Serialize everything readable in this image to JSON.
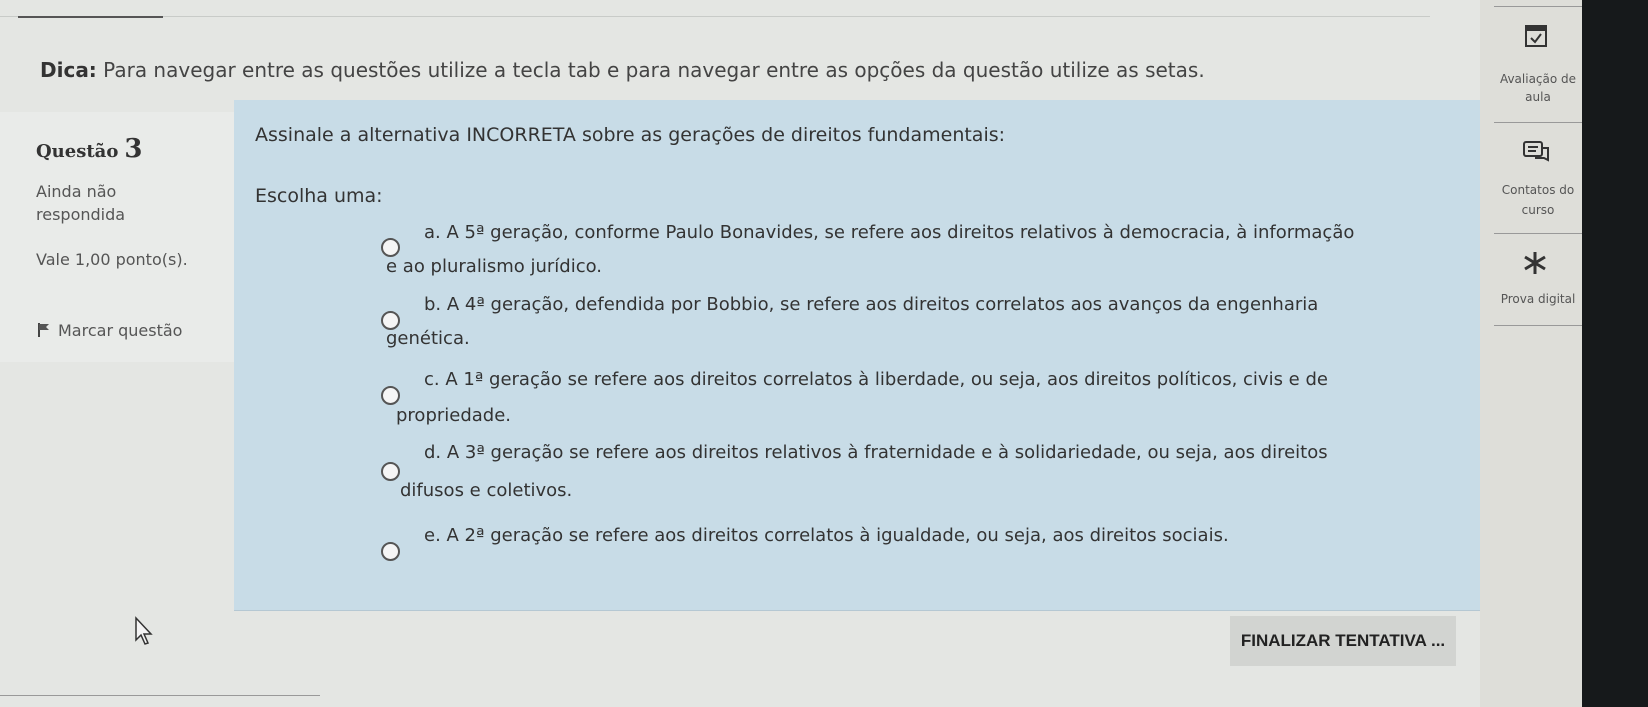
{
  "hint": {
    "label": "Dica:",
    "text": "Para navegar entre as questões utilize a tecla tab e para navegar entre as opções da questão utilize as setas."
  },
  "question": {
    "label": "Questão",
    "number": "3",
    "status": "Ainda não respondida",
    "value": "Vale 1,00 ponto(s).",
    "flag_label": "Marcar questão"
  },
  "prompt": "Assinale a alternativa INCORRETA sobre as gerações de direitos fundamentais:",
  "choose": "Escolha uma:",
  "options": [
    {
      "line1": "a. A 5ª geração, conforme Paulo Bonavides, se refere aos direitos relativos à democracia, à informação",
      "line2": "e ao pluralismo jurídico."
    },
    {
      "line1": "b. A 4ª geração, defendida por Bobbio, se refere aos direitos correlatos aos avanços da engenharia",
      "line2": "genética."
    },
    {
      "line1": "c. A 1ª geração se refere aos direitos correlatos à liberdade, ou seja, aos direitos políticos, civis e de",
      "line2": "propriedade."
    },
    {
      "line1": "d. A 3ª geração se refere aos direitos relativos à fraternidade e à solidariedade, ou seja, aos direitos",
      "line2": "difusos e coletivos."
    },
    {
      "line1": "e. A 2ª geração se refere aos direitos correlatos à igualdade, ou seja, aos direitos sociais.",
      "line2": ""
    }
  ],
  "finish_button": "FINALIZAR TENTATIVA ...",
  "rail": {
    "items": [
      {
        "label": "Avaliação de aula",
        "icon": "checklist-icon"
      },
      {
        "label": "Contatos do curso",
        "icon": "chat-icon"
      },
      {
        "label": "Prova digital",
        "icon": "asterisk-icon"
      }
    ]
  }
}
